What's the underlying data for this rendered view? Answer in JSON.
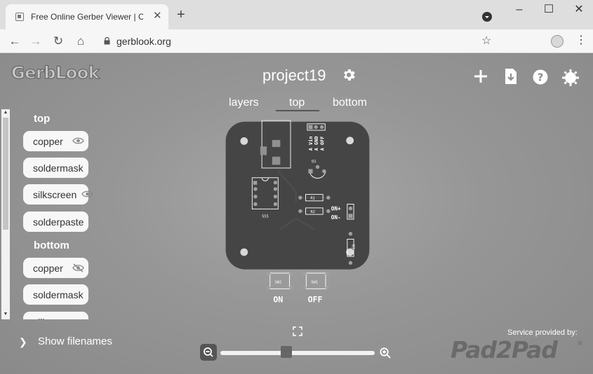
{
  "browser": {
    "tab_title": "Free Online Gerber Viewer | Circ...",
    "new_tab": "+",
    "url": "gerblook.org",
    "window_controls": {
      "minimize": "–",
      "maximize": "☐",
      "close": "✕"
    }
  },
  "app": {
    "logo": "GerbLook",
    "project_title": "project19",
    "view_tabs": [
      "layers",
      "top",
      "bottom"
    ],
    "active_view_tab": "top",
    "sidebar": {
      "top_label": "top",
      "top_layers": [
        {
          "label": "copper",
          "icon": "eye-icon"
        },
        {
          "label": "soldermask",
          "icon": ""
        },
        {
          "label": "silkscreen",
          "icon": "eye-icon"
        },
        {
          "label": "solderpaste",
          "icon": ""
        }
      ],
      "bottom_label": "bottom",
      "bottom_layers": [
        {
          "label": "copper",
          "icon": "eye-off-icon"
        },
        {
          "label": "soldermask",
          "icon": ""
        },
        {
          "label": "silkscreen",
          "icon": ""
        }
      ]
    },
    "show_filenames": "Show filenames",
    "zoom_level": 0.42,
    "service_text": "Service provided by:",
    "service_logo": "Pad2Pad"
  },
  "board": {
    "silkscreen": {
      "header_labels": [
        "A OFF",
        "A GND",
        "A Vin"
      ],
      "q1": "Q1",
      "on_plus": "ON+",
      "on_minus": "ON-",
      "ic_label": "555",
      "r1": "R1",
      "r2": "R2",
      "r3": "R3",
      "sw2": "SW2",
      "sw1": "SW1",
      "on": "ON",
      "off": "OFF"
    },
    "colors": {
      "mask": "#454545",
      "silk": "#ffffff",
      "copper": "#a0a0a0",
      "hole": "#d8d8d8"
    }
  }
}
